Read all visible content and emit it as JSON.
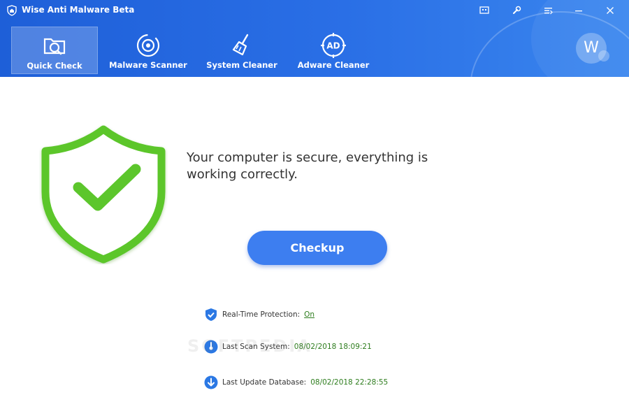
{
  "window": {
    "title": "Wise Anti Malware Beta",
    "titlebar_buttons": [
      {
        "name": "feedback-icon"
      },
      {
        "name": "settings-wrench-icon"
      },
      {
        "name": "menu-icon"
      },
      {
        "name": "minimize-icon"
      },
      {
        "name": "close-icon"
      }
    ]
  },
  "nav": {
    "tabs": [
      {
        "label": "Quick Check",
        "icon": "folder-search-icon",
        "active": true
      },
      {
        "label": "Malware Scanner",
        "icon": "radar-icon",
        "active": false
      },
      {
        "label": "System Cleaner",
        "icon": "broom-icon",
        "active": false
      },
      {
        "label": "Adware Cleaner",
        "icon": "ad-target-icon",
        "active": false
      }
    ],
    "ad_icon_text": "AD"
  },
  "account": {
    "avatar_letter": "W"
  },
  "main": {
    "status_message": "Your computer is secure, everything is working correctly.",
    "checkup_label": "Checkup",
    "info": [
      {
        "label": "Real-Time Protection:",
        "value": "On",
        "icon": "shield-check-icon"
      },
      {
        "label": "Last Scan System:",
        "value": "08/02/2018 18:09:21",
        "icon": "scan-gauge-icon"
      },
      {
        "label": "Last Update Database:",
        "value": "08/02/2018 22:28:55",
        "icon": "download-arrow-icon"
      }
    ]
  },
  "watermark": "SOFTPEDIA",
  "colors": {
    "header_blue": "#2a6fe6",
    "button_blue": "#3d7ef0",
    "shield_green": "#5cc62c",
    "value_green": "#2e7d1e"
  }
}
